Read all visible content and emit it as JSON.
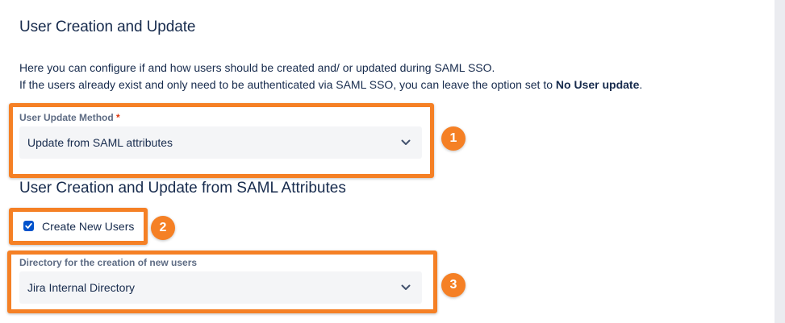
{
  "section": {
    "title": "User Creation and Update",
    "description_line1": "Here you can configure if and how users should be created and/ or updated during SAML SSO.",
    "description_line2_prefix": "If the users already exist and only need to be authenticated via SAML SSO, you can leave the option set to ",
    "description_line2_bold": "No User update",
    "description_line2_suffix": "."
  },
  "user_update_method": {
    "label": "User Update Method",
    "required_mark": "*",
    "selected_value": "Update from SAML attributes"
  },
  "saml_attributes_section": {
    "title": "User Creation and Update from SAML Attributes"
  },
  "create_new_users": {
    "label": "Create New Users",
    "checked": true
  },
  "directory": {
    "label": "Directory for the creation of new users",
    "selected_value": "Jira Internal Directory"
  },
  "annotations": {
    "badge_1": "1",
    "badge_2": "2",
    "badge_3": "3",
    "highlight_color": "#f58025"
  },
  "colors": {
    "checkbox_accent": "#0052cc",
    "text": "#172b4d",
    "label": "#5e6c84",
    "required": "#de350b"
  },
  "icons": {
    "select_arrow": "chevron-down-icon",
    "checkbox_check": "checkmark-icon"
  }
}
